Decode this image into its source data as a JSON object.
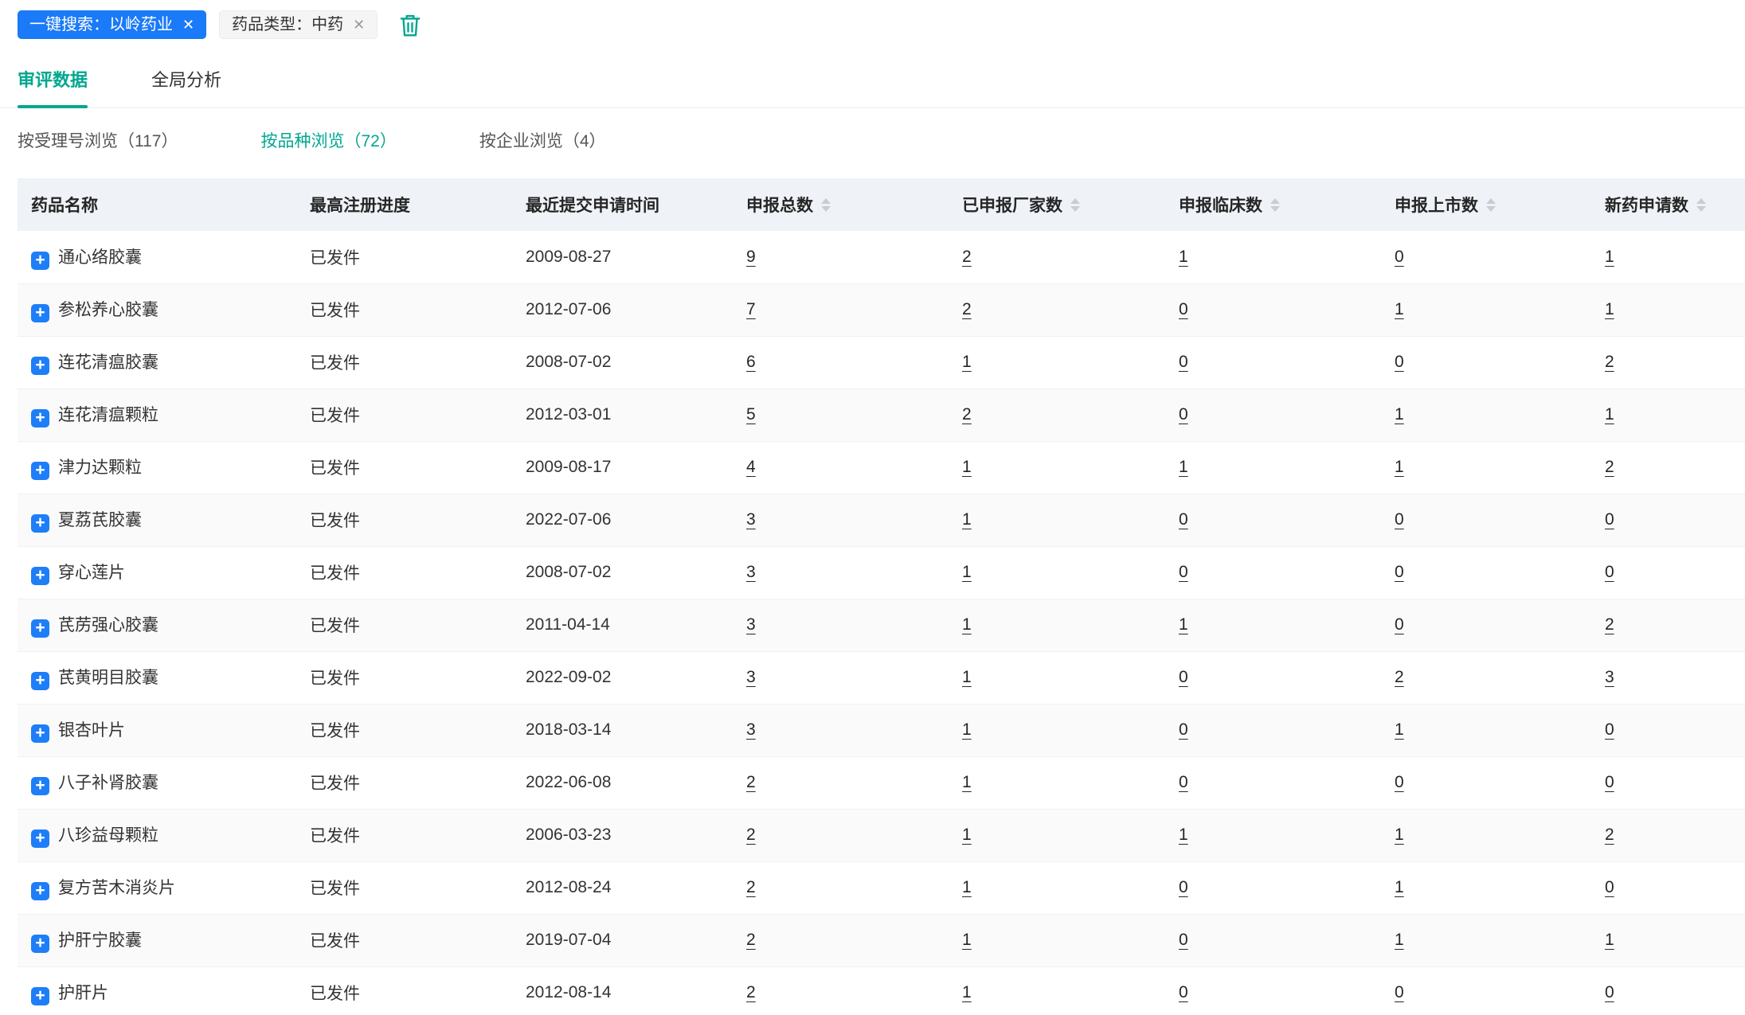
{
  "colors": {
    "accent": "#00a78e",
    "blue": "#1a7af8"
  },
  "icons": {
    "close": "✕",
    "plus": "+",
    "trash": "trash-icon",
    "sort": "caret-up-down"
  },
  "filter_bar": {
    "search_tag": "一键搜索：以岭药业",
    "type_tag": "药品类型：中药"
  },
  "tabs": [
    {
      "label": "审评数据",
      "active": true
    },
    {
      "label": "全局分析",
      "active": false
    }
  ],
  "subtabs": [
    {
      "label": "按受理号浏览（117）",
      "active": false
    },
    {
      "label": "按品种浏览（72）",
      "active": true
    },
    {
      "label": "按企业浏览（4）",
      "active": false
    }
  ],
  "table": {
    "headers": [
      {
        "label": "药品名称",
        "sortable": false
      },
      {
        "label": "最高注册进度",
        "sortable": false
      },
      {
        "label": "最近提交申请时间",
        "sortable": false
      },
      {
        "label": "申报总数",
        "sortable": true
      },
      {
        "label": "已申报厂家数",
        "sortable": true
      },
      {
        "label": "申报临床数",
        "sortable": true
      },
      {
        "label": "申报上市数",
        "sortable": true
      },
      {
        "label": "新药申请数",
        "sortable": true
      }
    ],
    "rows": [
      {
        "name": "通心络胶囊",
        "progress": "已发件",
        "date": "2009-08-27",
        "counts": [
          "9",
          "2",
          "1",
          "0",
          "1"
        ]
      },
      {
        "name": "参松养心胶囊",
        "progress": "已发件",
        "date": "2012-07-06",
        "counts": [
          "7",
          "2",
          "0",
          "1",
          "1"
        ]
      },
      {
        "name": "连花清瘟胶囊",
        "progress": "已发件",
        "date": "2008-07-02",
        "counts": [
          "6",
          "1",
          "0",
          "0",
          "2"
        ]
      },
      {
        "name": "连花清瘟颗粒",
        "progress": "已发件",
        "date": "2012-03-01",
        "counts": [
          "5",
          "2",
          "0",
          "1",
          "1"
        ]
      },
      {
        "name": "津力达颗粒",
        "progress": "已发件",
        "date": "2009-08-17",
        "counts": [
          "4",
          "1",
          "1",
          "1",
          "2"
        ]
      },
      {
        "name": "夏荔芪胶囊",
        "progress": "已发件",
        "date": "2022-07-06",
        "counts": [
          "3",
          "1",
          "0",
          "0",
          "0"
        ]
      },
      {
        "name": "穿心莲片",
        "progress": "已发件",
        "date": "2008-07-02",
        "counts": [
          "3",
          "1",
          "0",
          "0",
          "0"
        ]
      },
      {
        "name": "芪苈强心胶囊",
        "progress": "已发件",
        "date": "2011-04-14",
        "counts": [
          "3",
          "1",
          "1",
          "0",
          "2"
        ]
      },
      {
        "name": "芪黄明目胶囊",
        "progress": "已发件",
        "date": "2022-09-02",
        "counts": [
          "3",
          "1",
          "0",
          "2",
          "3"
        ]
      },
      {
        "name": "银杏叶片",
        "progress": "已发件",
        "date": "2018-03-14",
        "counts": [
          "3",
          "1",
          "0",
          "1",
          "0"
        ]
      },
      {
        "name": "八子补肾胶囊",
        "progress": "已发件",
        "date": "2022-06-08",
        "counts": [
          "2",
          "1",
          "0",
          "0",
          "0"
        ]
      },
      {
        "name": "八珍益母颗粒",
        "progress": "已发件",
        "date": "2006-03-23",
        "counts": [
          "2",
          "1",
          "1",
          "1",
          "2"
        ]
      },
      {
        "name": "复方苦木消炎片",
        "progress": "已发件",
        "date": "2012-08-24",
        "counts": [
          "2",
          "1",
          "0",
          "1",
          "0"
        ]
      },
      {
        "name": "护肝宁胶囊",
        "progress": "已发件",
        "date": "2019-07-04",
        "counts": [
          "2",
          "1",
          "0",
          "1",
          "1"
        ]
      },
      {
        "name": "护肝片",
        "progress": "已发件",
        "date": "2012-08-14",
        "counts": [
          "2",
          "1",
          "0",
          "0",
          "0"
        ]
      }
    ]
  }
}
